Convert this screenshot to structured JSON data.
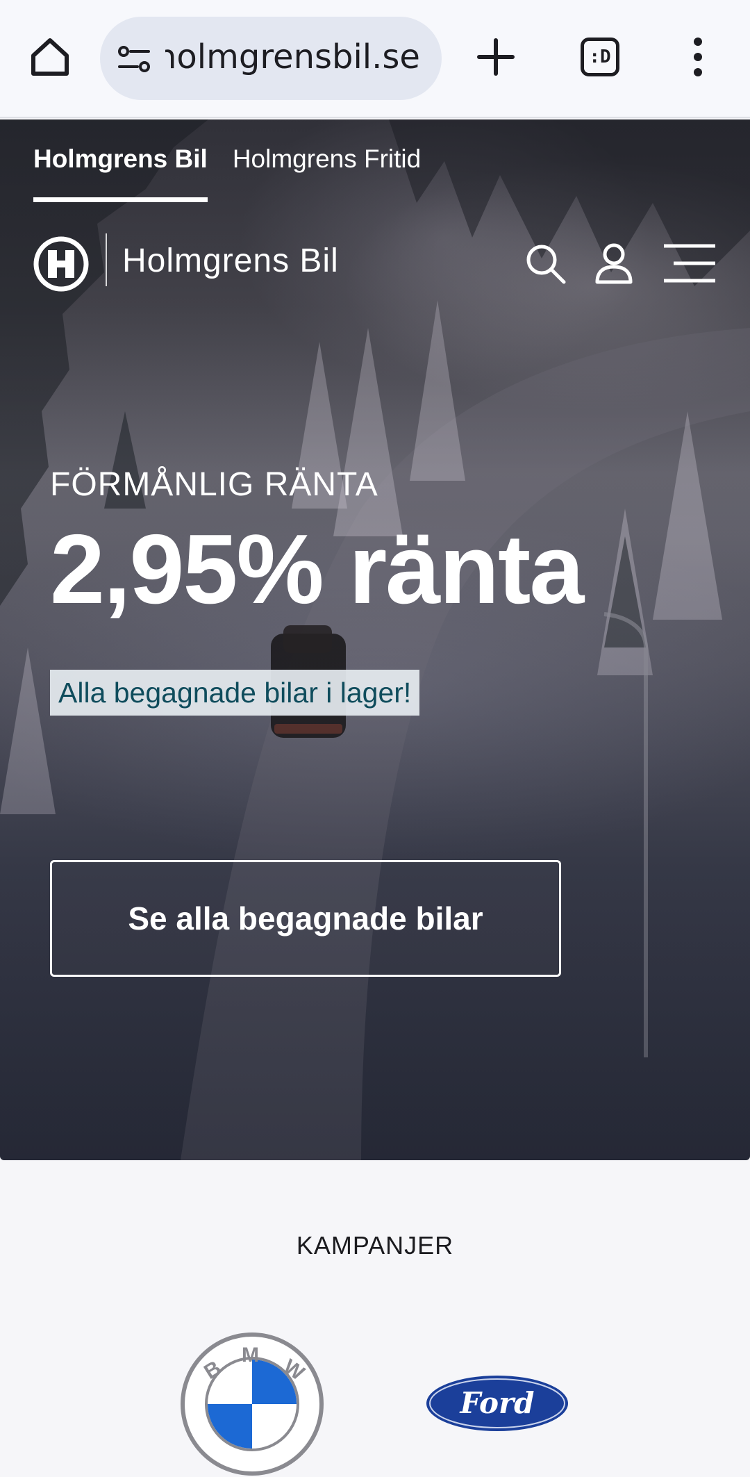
{
  "browser": {
    "url": "holmgrensbil.se",
    "tab_switcher_label": ":D"
  },
  "site": {
    "brand_tabs": [
      {
        "label": "Holmgrens Bil",
        "active": true
      },
      {
        "label": "Holmgrens Fritid",
        "active": false
      }
    ],
    "logo_text": "Holmgrens Bil",
    "icons": [
      "search-icon",
      "user-icon",
      "hamburger-menu-icon"
    ]
  },
  "hero": {
    "eyebrow": "FÖRMÅNLIG RÄNTA",
    "headline": "2,95% ränta",
    "tagline": "Alla begagnade bilar i lager!",
    "cta_label": "Se alla begagnade bilar"
  },
  "campaigns": {
    "title": "KAMPANJER",
    "brands": [
      "BMW",
      "Ford"
    ]
  },
  "colors": {
    "tagline_text": "#0f4c5c",
    "tagline_bg": "#e6ecf0",
    "bmw_blue": "#1c69d4",
    "ford_blue": "#1b3f9a"
  }
}
